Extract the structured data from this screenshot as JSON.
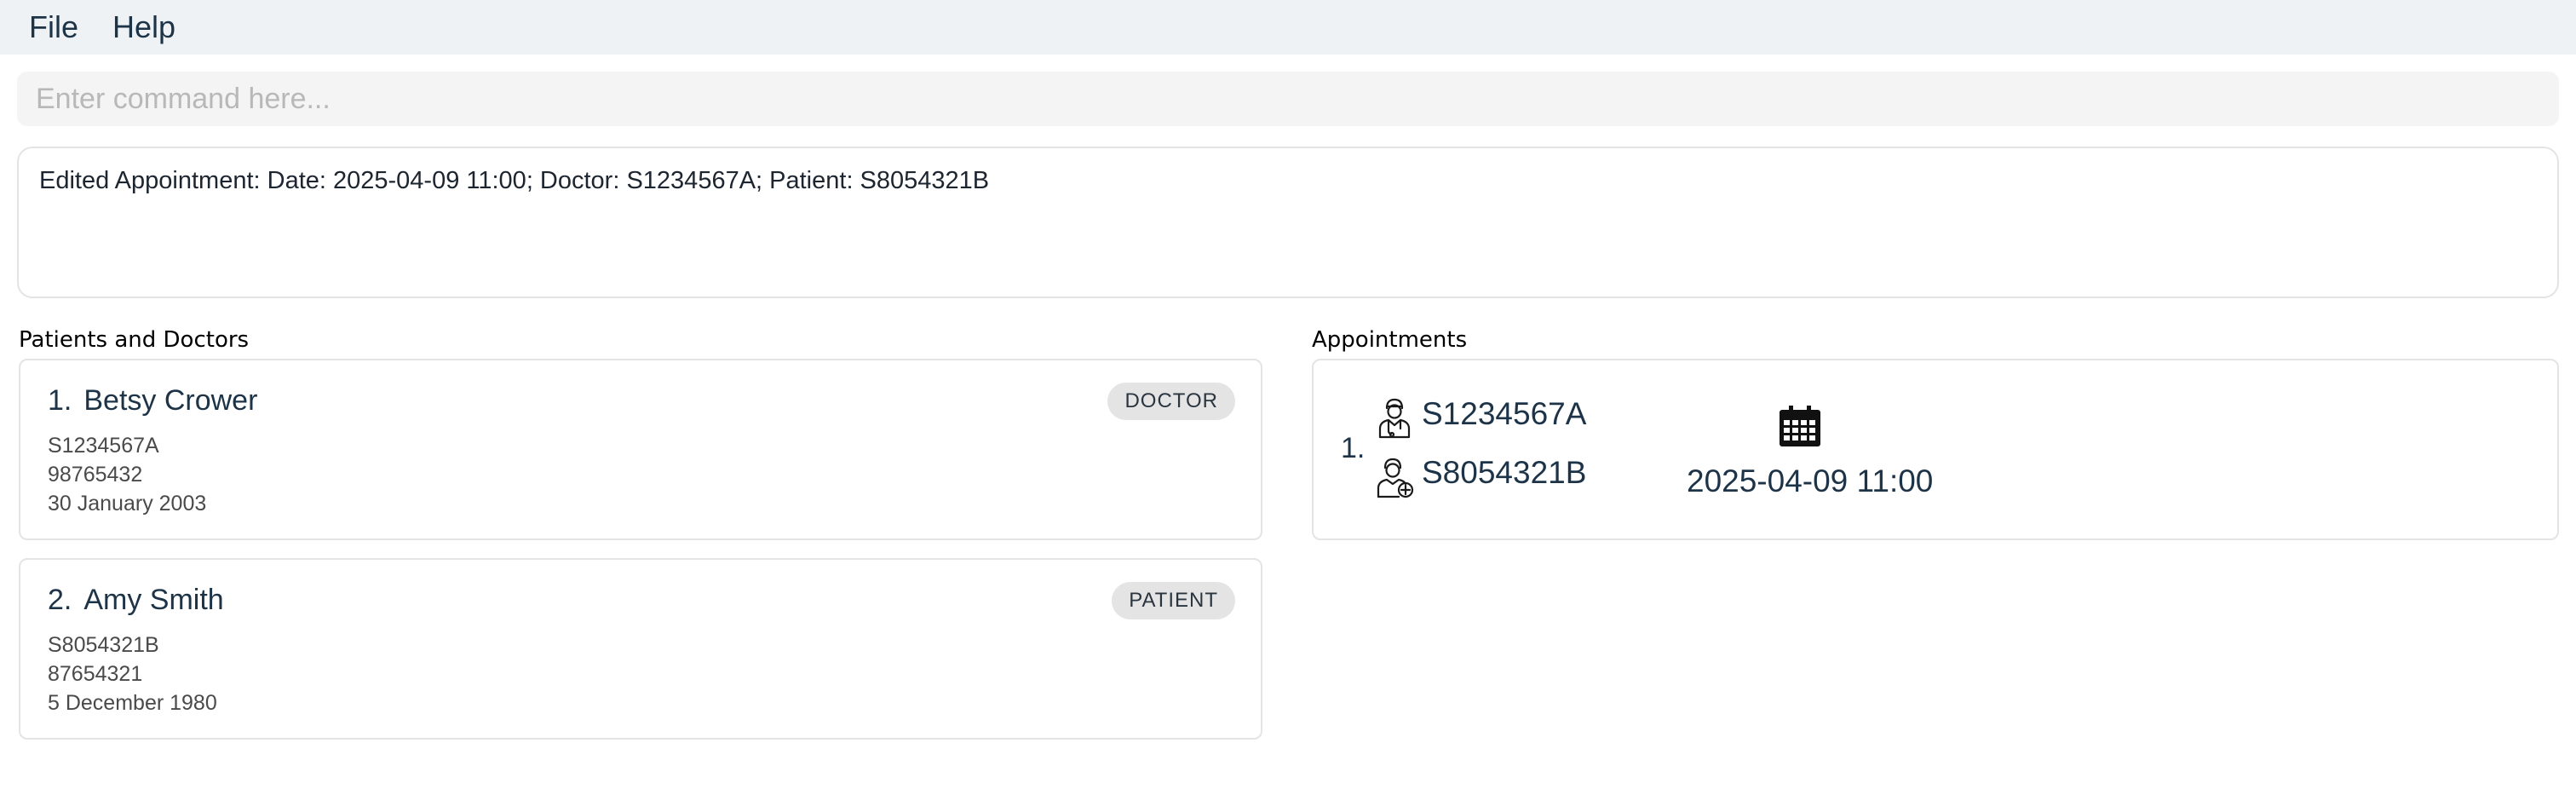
{
  "menu": {
    "file": "File",
    "help": "Help"
  },
  "command": {
    "placeholder": "Enter command here...",
    "value": ""
  },
  "result": {
    "text": "Edited Appointment: Date: 2025-04-09 11:00; Doctor: S1234567A; Patient: S8054321B"
  },
  "persons_panel": {
    "title": "Patients  and  Doctors",
    "items": [
      {
        "index": "1.",
        "name": "Betsy Crower",
        "tag": "DOCTOR",
        "nric": "S1234567A",
        "phone": "98765432",
        "dob": "30 January 2003"
      },
      {
        "index": "2.",
        "name": "Amy Smith",
        "tag": "PATIENT",
        "nric": "S8054321B",
        "phone": "87654321",
        "dob": "5 December 1980"
      }
    ]
  },
  "appointments_panel": {
    "title": "Appointments",
    "items": [
      {
        "index": "1.",
        "doctor_nric": "S1234567A",
        "patient_nric": "S8054321B",
        "datetime": "2025-04-09 11:00"
      }
    ]
  },
  "icons": {
    "doctor": "doctor-icon",
    "patient": "patient-icon",
    "calendar": "calendar-icon"
  }
}
